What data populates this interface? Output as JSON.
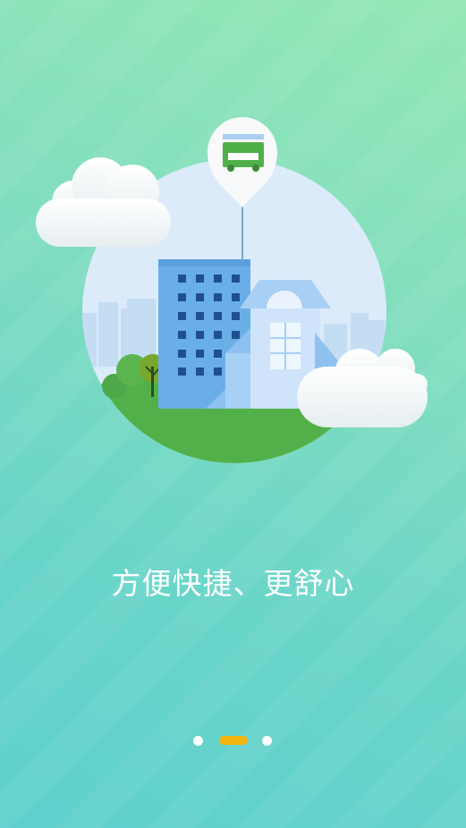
{
  "onboarding": {
    "headline": "方便快捷、更舒心",
    "illustration_icon": "bus-location-pin-icon",
    "pager": {
      "total_pages": 3,
      "current_page": 2
    }
  },
  "colors": {
    "accent": "#f5b50f",
    "bg_top": "#93e8b4",
    "bg_bottom": "#5fd0cd",
    "building": "#6aaee8",
    "grass": "#52b04a"
  }
}
